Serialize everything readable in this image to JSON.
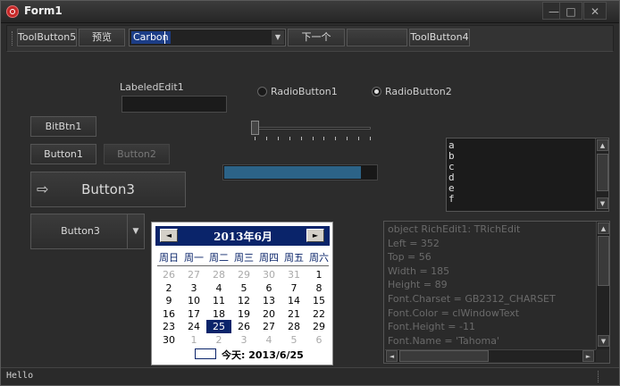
{
  "window": {
    "title": "Form1",
    "minimize_glyph": "—",
    "maximize_glyph": "□",
    "close_glyph": "✕"
  },
  "toolbar": {
    "buttons": [
      "ToolButton5",
      "预览",
      "下一个",
      "",
      "ToolButton4"
    ],
    "combo_value": "Carbon"
  },
  "labeled_edit": {
    "label": "LabeledEdit1",
    "value": ""
  },
  "radios": [
    {
      "label": "RadioButton1",
      "checked": false
    },
    {
      "label": "RadioButton2",
      "checked": true
    }
  ],
  "buttons": {
    "bitbtn1": "BitBtn1",
    "button1": "Button1",
    "button2": "Button2",
    "button3_large": "Button3",
    "button3_split": "Button3"
  },
  "trackbar": {
    "position": 0,
    "tick_count": 11
  },
  "progress": {
    "percent": 90
  },
  "listbox": {
    "items": [
      "a",
      "b",
      "c",
      "d",
      "e",
      "f"
    ]
  },
  "richedit": {
    "lines": [
      "object RichEdit1: TRichEdit",
      "  Left = 352",
      "  Top = 56",
      "  Width = 185",
      "  Height = 89",
      "  Font.Charset = GB2312_CHARSET",
      "  Font.Color = clWindowText",
      "  Font.Height = -11",
      "  Font.Name = 'Tahoma'"
    ]
  },
  "calendar": {
    "title": "2013年6月",
    "weekdays": [
      "周日",
      "周一",
      "周二",
      "周三",
      "周四",
      "周五",
      "周六"
    ],
    "days": [
      [
        "26",
        "27",
        "28",
        "29",
        "30",
        "31",
        "1"
      ],
      [
        "2",
        "3",
        "4",
        "5",
        "6",
        "7",
        "8"
      ],
      [
        "9",
        "10",
        "11",
        "12",
        "13",
        "14",
        "15"
      ],
      [
        "16",
        "17",
        "18",
        "19",
        "20",
        "21",
        "22"
      ],
      [
        "23",
        "24",
        "25",
        "26",
        "27",
        "28",
        "29"
      ],
      [
        "30",
        "1",
        "2",
        "3",
        "4",
        "5",
        "6"
      ]
    ],
    "selected_day": "25",
    "today_label": "今天: 2013/6/25"
  },
  "statusbar": {
    "text": "Hello"
  },
  "icons": {
    "prev": "◄",
    "next": "►",
    "dropdown": "▼",
    "up": "▲",
    "arrow": "⇨"
  }
}
